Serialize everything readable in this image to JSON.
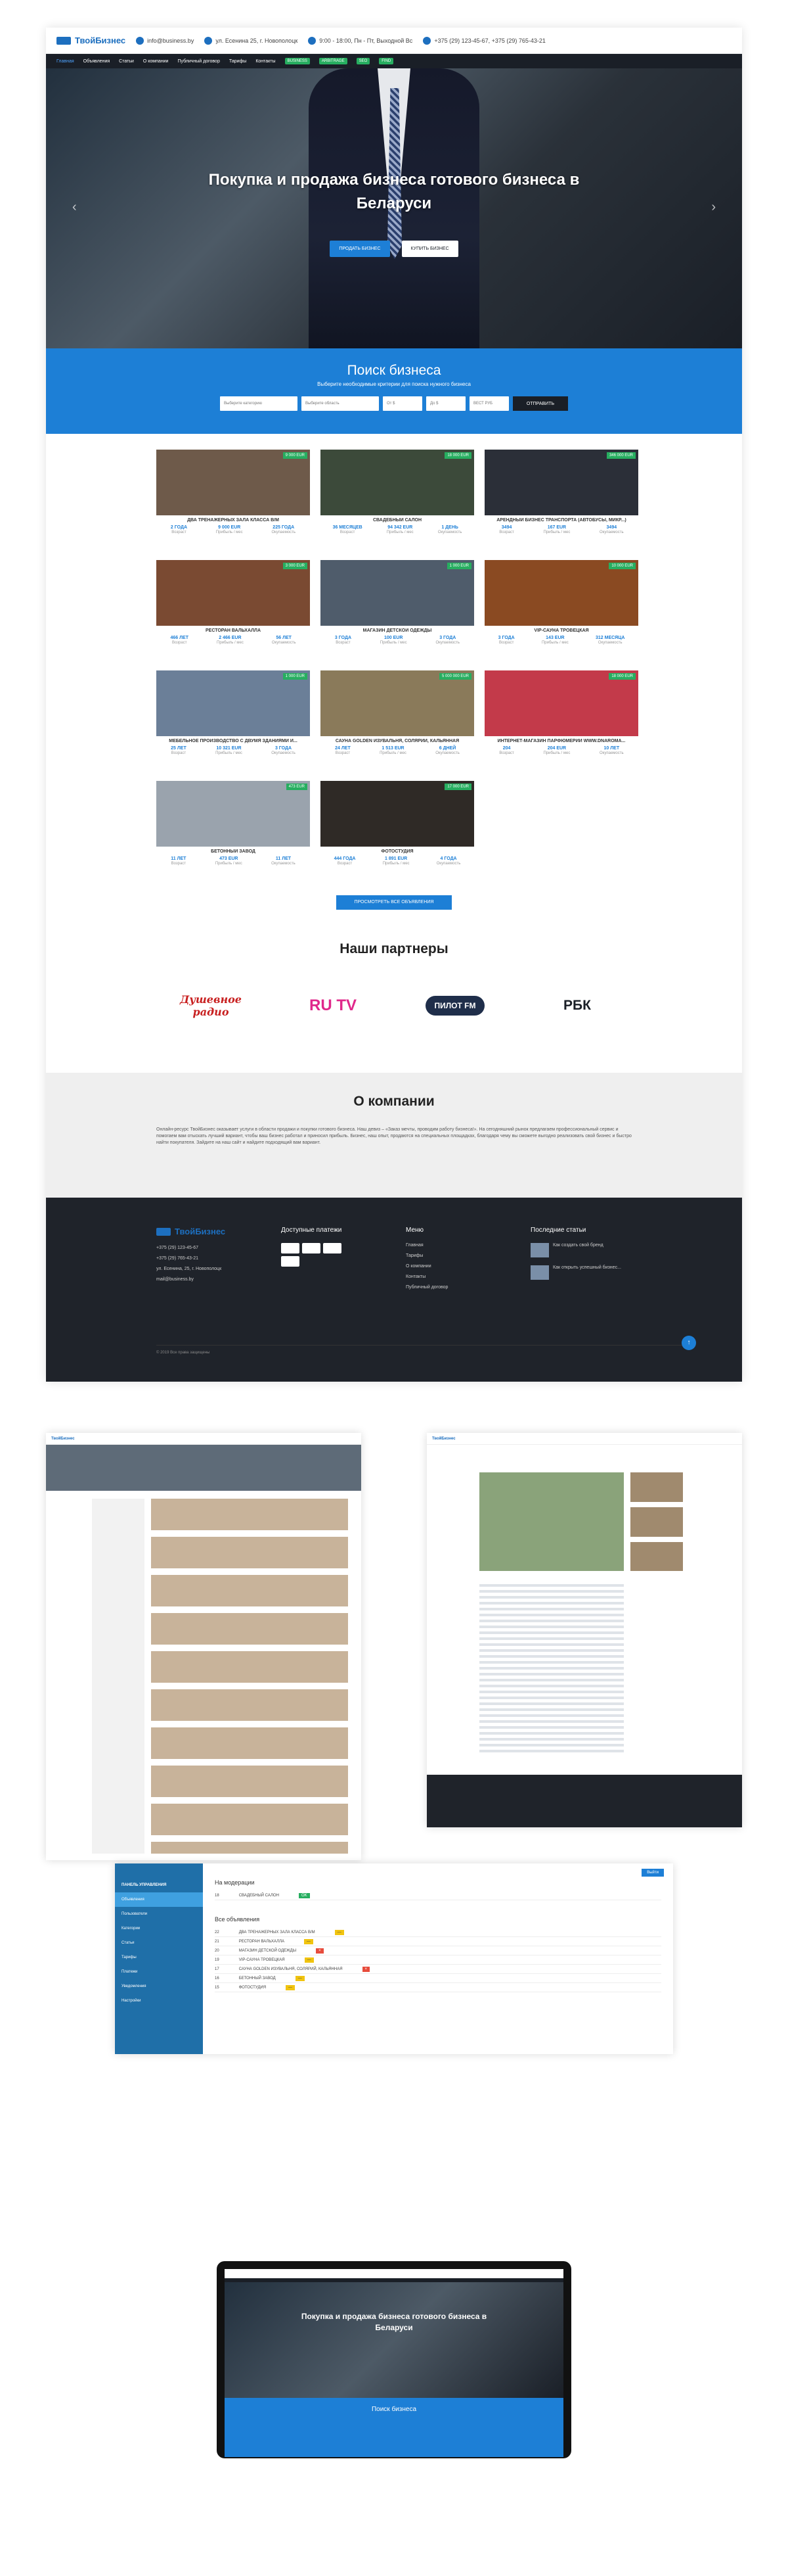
{
  "header": {
    "logo": "ТвойБизнес",
    "email": "info@business.by",
    "address": "ул. Есенина 25, г. Новополоцк",
    "hours": "9:00 - 18:00, Пн - Пт, Выходной Вс",
    "phones": "+375 (29) 123-45-67, +375 (29) 765-43-21"
  },
  "nav": [
    "Главная",
    "Объявления",
    "Статьи",
    "О компании",
    "Публичный договор",
    "Тарифы",
    "Контакты"
  ],
  "nav_tags": [
    "BUSINESS",
    "ARBITRAGE",
    "SEO",
    "FIND"
  ],
  "hero": {
    "title": "Покупка и продажа бизнеса готового бизнеса в Беларуси",
    "sell_button": "ПРОДАТЬ БИЗНЕС",
    "buy_button": "КУПИТЬ БИЗНЕС"
  },
  "search": {
    "title": "Поиск бизнеса",
    "subtitle": "Выберите необходимые критерии для поиска нужного бизнеса",
    "fields": [
      "Выберите категорию",
      "Выберите область",
      "От $",
      "До $",
      "ВЕСТ РУБ"
    ],
    "button": "ОТПРАВИТЬ"
  },
  "listings": [
    {
      "title": "ДВА ТРЕНАЖЕРНЫХ ЗАЛА КЛАССА B/M",
      "price": "9 000 EUR",
      "age": "2 ГОДА",
      "sum": "9 000 EUR",
      "area": "225 ГОДА"
    },
    {
      "title": "СВАДЕБНЫЙ САЛОН",
      "price": "18 000 EUR",
      "age": "36 МЕСЯЦЕВ",
      "sum": "94 342 EUR",
      "area": "1 ДЕНЬ"
    },
    {
      "title": "АРЕНДНЫЙ БИЗНЕС ТРАНСПОРТА (АВТОБУСЫ, МИКР...)",
      "price": "346 000 EUR",
      "age": "3494",
      "sum": "167 EUR",
      "area": "3494"
    },
    {
      "title": "РЕСТОРАН ВАЛЬХАЛЛА",
      "price": "3 000 EUR",
      "age": "466 ЛЕТ",
      "sum": "2 466 EUR",
      "area": "56 ЛЕТ"
    },
    {
      "title": "МАГАЗИН ДЕТСКОЙ ОДЕЖДЫ",
      "price": "1 000 EUR",
      "age": "3 ГОДА",
      "sum": "100 EUR",
      "area": "3 ГОДА"
    },
    {
      "title": "VIP-САУНА ТРОВЕЦКАЯ",
      "price": "10 000 EUR",
      "age": "3 ГОДА",
      "sum": "143 EUR",
      "area": "312 МЕСЯЦА"
    },
    {
      "title": "МЕБЕЛЬНОЕ ПРОИЗВОДСТВО С ДВУМЯ ЗДАНИЯМИ И...",
      "price": "1 000 EUR",
      "age": "25 ЛЕТ",
      "sum": "10 321 EUR",
      "area": "3 ГОДА"
    },
    {
      "title": "САУНА GOLDEN ИЗУВАЛЬНЯ, СОЛЯРИЙ, КАЛЬЯННАЯ",
      "price": "5 000 000 EUR",
      "age": "24 ЛЕТ",
      "sum": "1 513 EUR",
      "area": "6 ДНЕЙ"
    },
    {
      "title": "ИНТЕРНЕТ-МАГАЗИН ПАРФЮМЕРИИ WWW.DNAROMA...",
      "price": "18 000 EUR",
      "age": "204",
      "sum": "204 EUR",
      "area": "10 ЛЕТ"
    },
    {
      "title": "БЕТОННЫЙ ЗАВОД",
      "price": "473 EUR",
      "age": "11 ЛЕТ",
      "sum": "473 EUR",
      "area": "11 ЛЕТ"
    },
    {
      "title": "ФОТОСТУДИЯ",
      "price": "17 000 EUR",
      "age": "444 ГОДА",
      "sum": "1 891 EUR",
      "area": "4 ГОДА"
    }
  ],
  "listing_labels": {
    "age": "Возраст",
    "profit": "Прибыль / мес",
    "payback": "Окупаемость"
  },
  "all_button": "ПРОСМОТРЕТЬ ВСЕ ОБЪЯВЛЕНИЯ",
  "partners": {
    "title": "Наши партнеры",
    "logos": [
      "Душевное радио",
      "RU TV",
      "ПИЛОТ FM",
      "РБК"
    ]
  },
  "about": {
    "title": "О компании",
    "text": "Онлайн-ресурс ТвойБизнес оказывает услуги в области продажи и покупки готового бизнеса. Наш девиз – «Заказ мечты, проводим работу бизнеса!». На сегодняшний рынок предлагаем профессиональный сервис и помогаем вам отыскать лучший вариант, чтобы ваш бизнес работал и приносил прибыль. Бизнес, наш опыт, продаются на специальных площадках, благодаря чему вы сможете выгодно реализовать свой бизнес и быстро найти покупателя. Зайдите на наш сайт и найдите подходящий вам вариант."
  },
  "footer": {
    "logo": "ТвойБизнес",
    "contacts": [
      "+375 (29) 123-45-67",
      "+375 (29) 765-43-21",
      "ул. Есенина, 25, г. Новополоцк",
      "mail@business.by"
    ],
    "payments_title": "Доступные платежи",
    "menu_title": "Меню",
    "menu": [
      "Главная",
      "Тарифы",
      "О компании",
      "Контакты",
      "Публичный договор"
    ],
    "articles_title": "Последние статьи",
    "articles": [
      "Как создать свой бренд",
      "Как открыть успешный бизнес..."
    ],
    "copyright": "© 2019 Все права защищены"
  },
  "admin": {
    "title": "ПАНЕЛЬ УПРАВЛЕНИЯ",
    "menu": [
      "Объявления",
      "Пользователи",
      "Категории",
      "Статьи",
      "Тарифы",
      "Платежи",
      "Уведомления",
      "Настройки"
    ],
    "section1": "На модерации",
    "section2": "Все объявления",
    "button": "Выйти"
  },
  "colors": {
    "accent": "#1d7fd6",
    "dark": "#1f232a",
    "price": "#27ae60"
  }
}
